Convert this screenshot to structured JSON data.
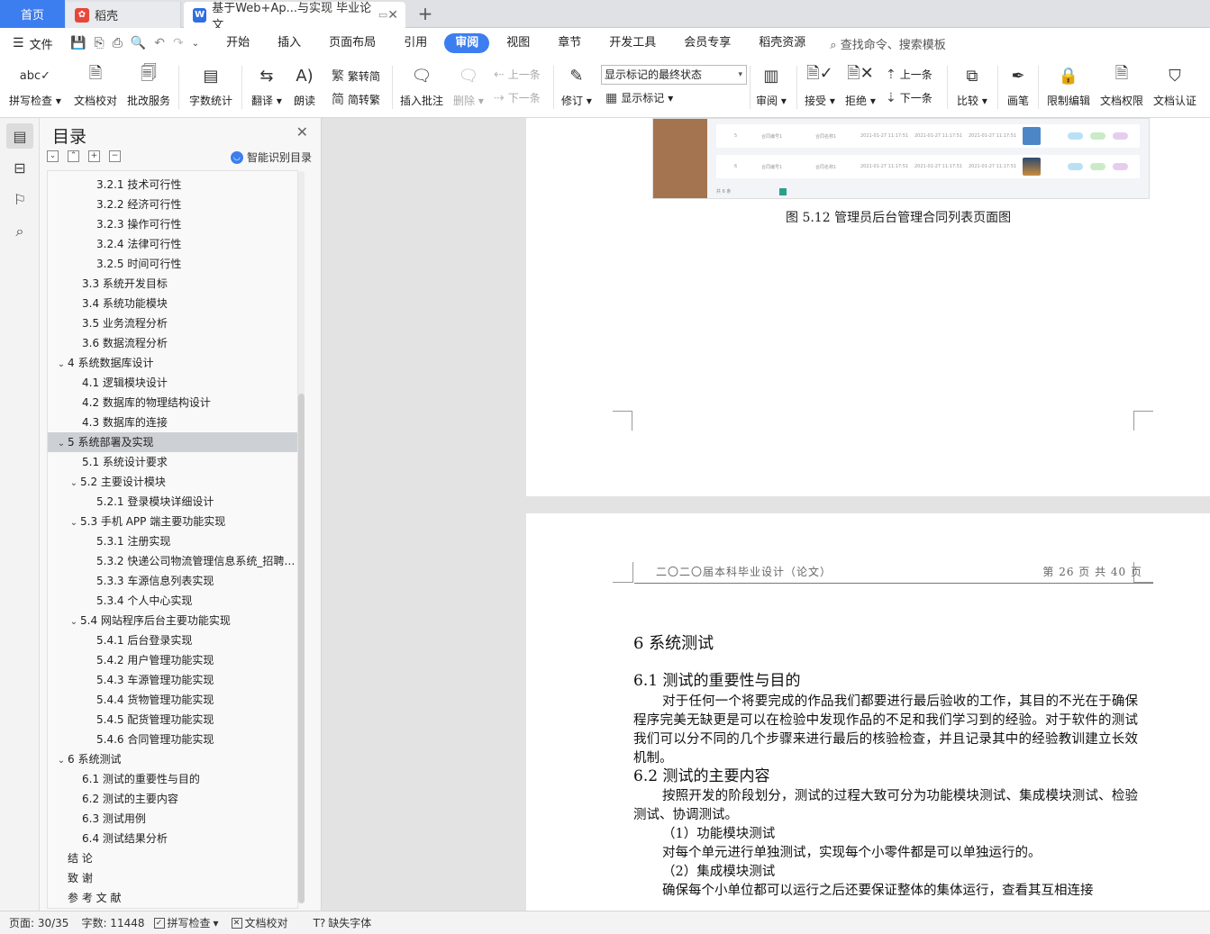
{
  "tabs": {
    "home": "首页",
    "daoke": "稻壳",
    "doc_title": "基于Web+Ap...与实现 毕业论文"
  },
  "menu": {
    "file": "文件",
    "tabs": [
      "开始",
      "插入",
      "页面布局",
      "引用",
      "审阅",
      "视图",
      "章节",
      "开发工具",
      "会员专享",
      "稻壳资源"
    ],
    "active_tab": "审阅",
    "search": "查找命令、搜索模板"
  },
  "toolbar": {
    "spell_check": "拼写检查",
    "doc_proof": "文档校对",
    "batch_service": "批改服务",
    "word_count": "字数统计",
    "translate": "翻译",
    "read_aloud": "朗读",
    "trad_to_simp": "繁转简",
    "simp_to_trad": "简转繁",
    "insert_comment": "插入批注",
    "delete": "删除",
    "prev_item": "上一条",
    "next_item": "下一条",
    "track": "修订",
    "markup_state": "显示标记的最终状态",
    "show_markup": "显示标记",
    "review": "审阅",
    "accept": "接受",
    "reject": "拒绝",
    "prev_change": "上一条",
    "next_change": "下一条",
    "compare": "比较",
    "ink": "画笔",
    "restrict_edit": "限制编辑",
    "doc_permission": "文档权限",
    "doc_cert": "文档认证"
  },
  "toc": {
    "title": "目录",
    "smart": "智能识别目录",
    "selected_index": 13,
    "items": [
      {
        "level": 3,
        "text": "3.2.1 技术可行性",
        "caret": ""
      },
      {
        "level": 3,
        "text": "3.2.2 经济可行性",
        "caret": ""
      },
      {
        "level": 3,
        "text": "3.2.3 操作可行性",
        "caret": ""
      },
      {
        "level": 3,
        "text": "3.2.4 法律可行性",
        "caret": ""
      },
      {
        "level": 3,
        "text": "3.2.5 时间可行性",
        "caret": ""
      },
      {
        "level": 2,
        "text": "3.3  系统开发目标",
        "caret": ""
      },
      {
        "level": 2,
        "text": "3.4  系统功能模块",
        "caret": ""
      },
      {
        "level": 2,
        "text": "3.5 业务流程分析",
        "caret": ""
      },
      {
        "level": 2,
        "text": "3.6 数据流程分析",
        "caret": ""
      },
      {
        "level": 1,
        "text": "4    系统数据库设计",
        "caret": "v"
      },
      {
        "level": 2,
        "text": "4.1 逻辑模块设计",
        "caret": ""
      },
      {
        "level": 2,
        "text": "4.2  数据库的物理结构设计",
        "caret": ""
      },
      {
        "level": 2,
        "text": "4.3  数据库的连接",
        "caret": ""
      },
      {
        "level": 1,
        "text": "5    系统部署及实现",
        "caret": "v"
      },
      {
        "level": 2,
        "text": "5.1  系统设计要求",
        "caret": ""
      },
      {
        "level": 2,
        "text": "5.2  主要设计模块",
        "caret": "v"
      },
      {
        "level": 3,
        "text": "5.2.1 登录模块详细设计",
        "caret": ""
      },
      {
        "level": 2,
        "text": "5.3 手机 APP 端主要功能实现",
        "caret": "v"
      },
      {
        "level": 3,
        "text": "5.3.1  注册实现",
        "caret": ""
      },
      {
        "level": 3,
        "text": "5.3.2 快递公司物流管理信息系统_招聘 ...",
        "caret": ""
      },
      {
        "level": 3,
        "text": "5.3.3 车源信息列表实现",
        "caret": ""
      },
      {
        "level": 3,
        "text": "5.3.4 个人中心实现",
        "caret": ""
      },
      {
        "level": 2,
        "text": "5.4 网站程序后台主要功能实现",
        "caret": "v"
      },
      {
        "level": 3,
        "text": "5.4.1  后台登录实现",
        "caret": ""
      },
      {
        "level": 3,
        "text": "5.4.2  用户管理功能实现",
        "caret": ""
      },
      {
        "level": 3,
        "text": "5.4.3  车源管理功能实现",
        "caret": ""
      },
      {
        "level": 3,
        "text": "5.4.4  货物管理功能实现",
        "caret": ""
      },
      {
        "level": 3,
        "text": "5.4.5  配货管理功能实现",
        "caret": ""
      },
      {
        "level": 3,
        "text": "5.4.6  合同管理功能实现",
        "caret": ""
      },
      {
        "level": 1,
        "text": "6    系统测试",
        "caret": "v"
      },
      {
        "level": 2,
        "text": "6.1  测试的重要性与目的",
        "caret": ""
      },
      {
        "level": 2,
        "text": "6.2  测试的主要内容",
        "caret": ""
      },
      {
        "level": 2,
        "text": "6.3  测试用例",
        "caret": ""
      },
      {
        "level": 2,
        "text": "6.4  测试结果分析",
        "caret": ""
      },
      {
        "level": 0,
        "text": "结    论",
        "caret": ""
      },
      {
        "level": 0,
        "text": "致    谢",
        "caret": ""
      },
      {
        "level": 0,
        "text": "参 考 文 献",
        "caret": ""
      }
    ]
  },
  "document": {
    "figure_caption": "图 5.12  管理员后台管理合同列表页面图",
    "header_left": "二〇二〇届本科毕业设计（论文）",
    "header_right": "第 26 页 共 40 页",
    "h_chapter": "6    系统测试",
    "h_61": "6.1  测试的重要性与目的",
    "p_61": "对于任何一个将要完成的作品我们都要进行最后验收的工作，其目的不光在于确保程序完美无缺更是可以在检验中发现作品的不足和我们学习到的经验。对于软件的测试我们可以分不同的几个步骤来进行最后的核验检查，并且记录其中的经验教训建立长效机制。",
    "h_62": "6.2  测试的主要内容",
    "p_62": "按照开发的阶段划分，测试的过程大致可分为功能模块测试、集成模块测试、检验测试、协调测试。",
    "l1": "（1）功能模块测试",
    "l2": "对每个单元进行单独测试，实现每个小零件都是可以单独运行的。",
    "l3": "（2）集成模块测试",
    "l4": "确保每个小单位都可以运行之后还要保证整体的集体运行，查看其互相连接"
  },
  "status": {
    "page": "页面: 30/35",
    "words": "字数: 11448",
    "spell": "拼写检查",
    "proof": "文档校对",
    "missing_font": "缺失字体"
  }
}
